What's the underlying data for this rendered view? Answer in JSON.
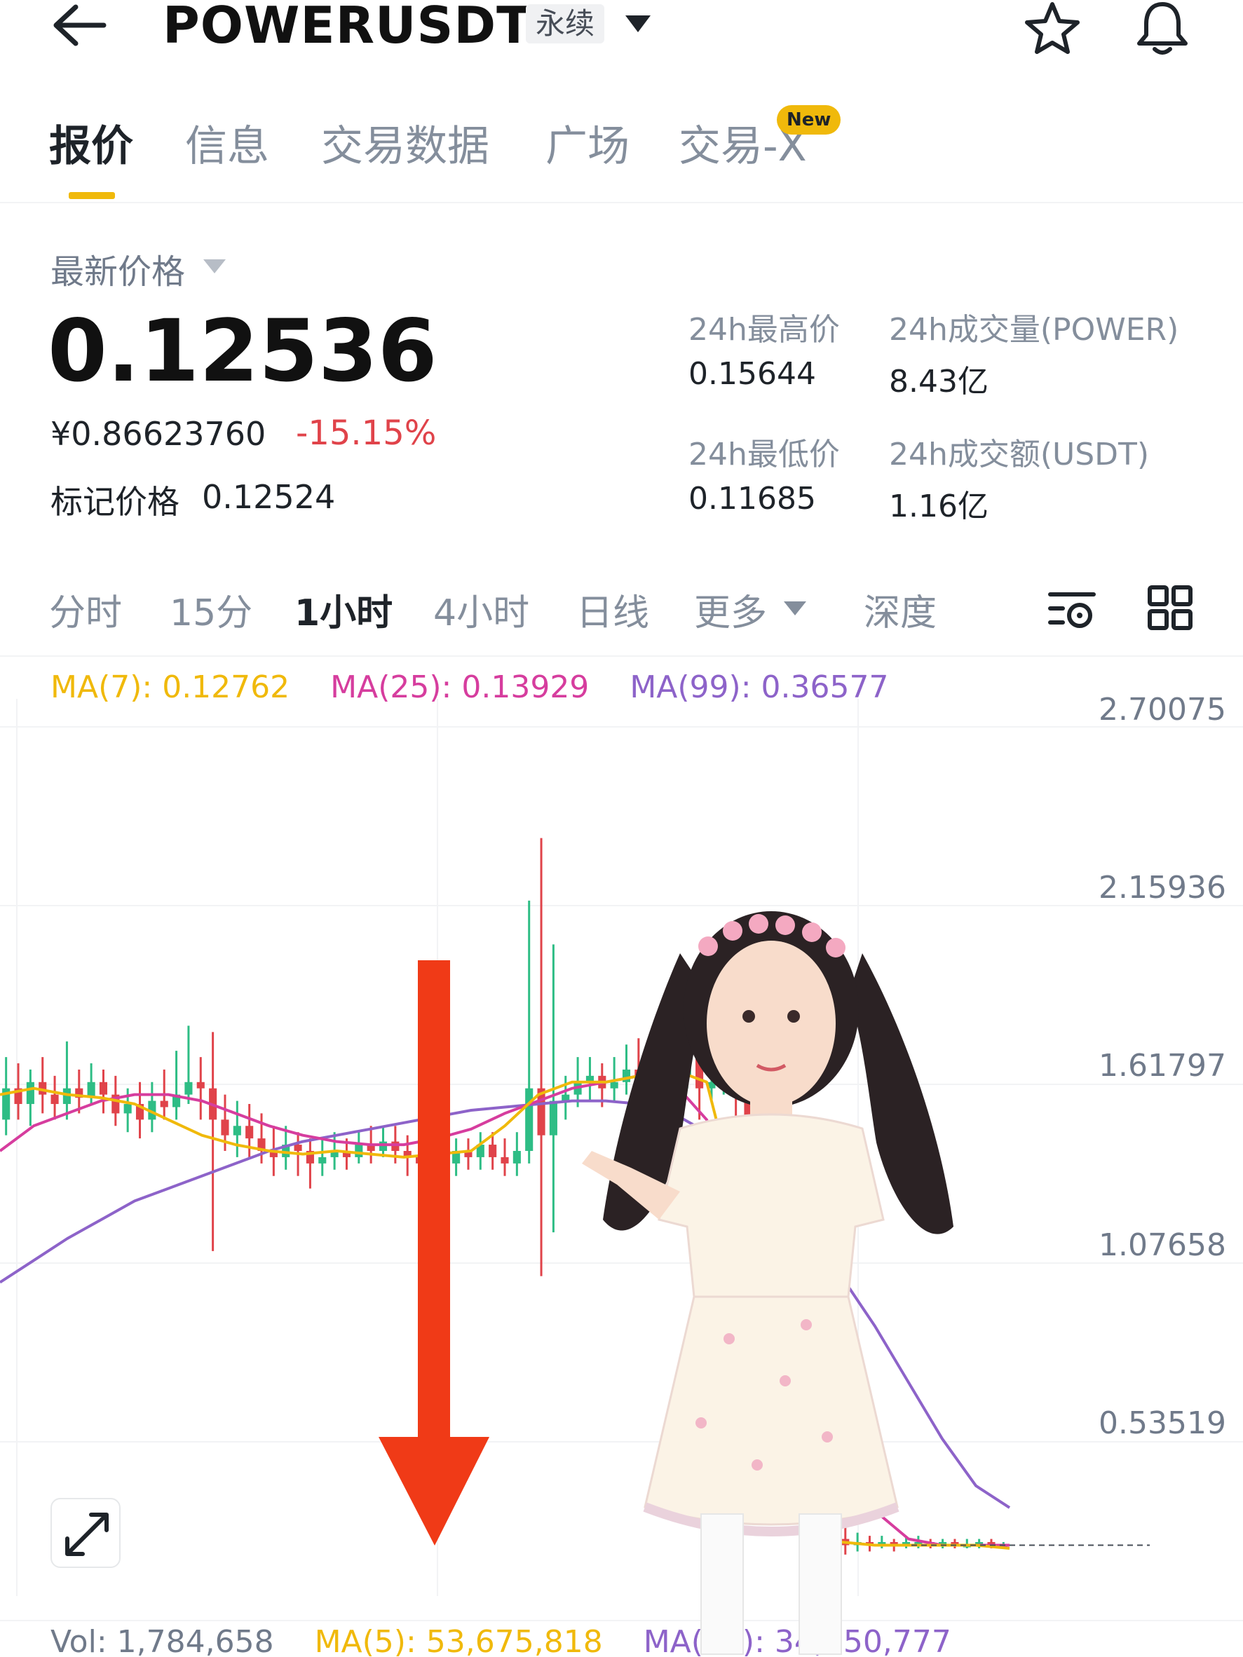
{
  "header": {
    "symbol": "POWERUSDT",
    "contract_type": "永续",
    "icons": [
      "back-arrow-icon",
      "chevron-down-icon",
      "star-icon",
      "bell-icon"
    ]
  },
  "tabs": [
    {
      "label": "报价",
      "active": true
    },
    {
      "label": "信息",
      "active": false
    },
    {
      "label": "交易数据",
      "active": false
    },
    {
      "label": "广场",
      "active": false
    },
    {
      "label": "交易-X",
      "active": false,
      "badge": "New"
    }
  ],
  "price": {
    "latest_label": "最新价格",
    "last": "0.12536",
    "cny": "¥0.86623760",
    "change": "-15.15%",
    "mark_label": "标记价格",
    "mark_value": "0.12524"
  },
  "stats": {
    "high_label": "24h最高价",
    "high_value": "0.15644",
    "vol_base_label": "24h成交量(POWER)",
    "vol_base_value": "8.43亿",
    "low_label": "24h最低价",
    "low_value": "0.11685",
    "vol_quote_label": "24h成交额(USDT)",
    "vol_quote_value": "1.16亿"
  },
  "intervals": [
    {
      "label": "分时",
      "active": false
    },
    {
      "label": "15分",
      "active": false
    },
    {
      "label": "1小时",
      "active": true
    },
    {
      "label": "4小时",
      "active": false
    },
    {
      "label": "日线",
      "active": false
    },
    {
      "label": "更多",
      "active": false
    },
    {
      "label": "深度",
      "active": false
    }
  ],
  "ma": {
    "ma7": "MA(7): 0.12762",
    "ma25": "MA(25): 0.13929",
    "ma99": "MA(99): 0.36577"
  },
  "volume": {
    "vol": "Vol: 1,784,658",
    "ma5": "MA(5): 53,675,818",
    "ma10": "MA(10): 34,650,777"
  },
  "colors": {
    "up": "#2ebd85",
    "down": "#e0434a",
    "ma7": "#f0b90b",
    "ma25": "#d63d9e",
    "ma99": "#8d63c9",
    "accent": "#f0b90b",
    "arrow": "#f03a17"
  },
  "chart_data": {
    "type": "candlestick",
    "ylim": [
      0.0,
      2.8
    ],
    "y_ticks": [
      "2.70075",
      "2.15936",
      "1.61797",
      "1.07658",
      "0.53519"
    ],
    "ma_lines": [
      "MA(7)",
      "MA(25)",
      "MA(99)"
    ],
    "candles": [
      [
        1.5,
        1.6,
        1.7,
        1.45
      ],
      [
        1.6,
        1.55,
        1.68,
        1.5
      ],
      [
        1.55,
        1.62,
        1.66,
        1.48
      ],
      [
        1.62,
        1.58,
        1.7,
        1.52
      ],
      [
        1.58,
        1.55,
        1.64,
        1.5
      ],
      [
        1.55,
        1.6,
        1.75,
        1.5
      ],
      [
        1.6,
        1.57,
        1.66,
        1.52
      ],
      [
        1.57,
        1.62,
        1.68,
        1.55
      ],
      [
        1.62,
        1.58,
        1.66,
        1.52
      ],
      [
        1.58,
        1.52,
        1.64,
        1.48
      ],
      [
        1.52,
        1.55,
        1.6,
        1.46
      ],
      [
        1.55,
        1.5,
        1.62,
        1.44
      ],
      [
        1.5,
        1.56,
        1.62,
        1.46
      ],
      [
        1.56,
        1.54,
        1.66,
        1.5
      ],
      [
        1.54,
        1.58,
        1.72,
        1.5
      ],
      [
        1.58,
        1.62,
        1.8,
        1.55
      ],
      [
        1.62,
        1.6,
        1.7,
        1.5
      ],
      [
        1.6,
        1.5,
        1.78,
        1.08
      ],
      [
        1.5,
        1.45,
        1.58,
        1.4
      ],
      [
        1.45,
        1.48,
        1.56,
        1.38
      ],
      [
        1.48,
        1.44,
        1.55,
        1.38
      ],
      [
        1.44,
        1.4,
        1.52,
        1.36
      ],
      [
        1.4,
        1.38,
        1.48,
        1.32
      ],
      [
        1.38,
        1.42,
        1.48,
        1.34
      ],
      [
        1.42,
        1.4,
        1.46,
        1.32
      ],
      [
        1.4,
        1.36,
        1.44,
        1.28
      ],
      [
        1.36,
        1.38,
        1.44,
        1.32
      ],
      [
        1.38,
        1.4,
        1.46,
        1.34
      ],
      [
        1.4,
        1.38,
        1.44,
        1.34
      ],
      [
        1.38,
        1.42,
        1.46,
        1.36
      ],
      [
        1.42,
        1.4,
        1.48,
        1.36
      ],
      [
        1.4,
        1.43,
        1.48,
        1.38
      ],
      [
        1.43,
        1.4,
        1.48,
        1.36
      ],
      [
        1.4,
        1.38,
        1.45,
        1.32
      ],
      [
        1.38,
        1.36,
        1.43,
        1.3
      ],
      [
        1.36,
        1.38,
        1.42,
        1.32
      ],
      [
        1.38,
        1.36,
        1.42,
        1.3
      ],
      [
        1.36,
        1.4,
        1.44,
        1.32
      ],
      [
        1.4,
        1.38,
        1.44,
        1.34
      ],
      [
        1.38,
        1.42,
        1.46,
        1.34
      ],
      [
        1.42,
        1.38,
        1.46,
        1.34
      ],
      [
        1.38,
        1.36,
        1.44,
        1.32
      ],
      [
        1.36,
        1.4,
        1.46,
        1.32
      ],
      [
        1.4,
        1.6,
        2.2,
        1.36
      ],
      [
        1.6,
        1.45,
        2.4,
        1.0
      ],
      [
        1.45,
        1.56,
        2.06,
        1.14
      ],
      [
        1.56,
        1.58,
        1.64,
        1.5
      ],
      [
        1.58,
        1.62,
        1.7,
        1.54
      ],
      [
        1.62,
        1.64,
        1.7,
        1.56
      ],
      [
        1.64,
        1.6,
        1.68,
        1.54
      ],
      [
        1.6,
        1.62,
        1.7,
        1.56
      ],
      [
        1.62,
        1.66,
        1.74,
        1.58
      ],
      [
        1.66,
        1.6,
        1.76,
        1.56
      ],
      [
        1.6,
        1.62,
        1.7,
        1.56
      ],
      [
        1.62,
        1.58,
        1.68,
        1.52
      ],
      [
        1.58,
        1.64,
        1.76,
        1.52
      ],
      [
        1.64,
        1.7,
        1.76,
        1.6
      ],
      [
        1.7,
        1.6,
        1.78,
        1.5
      ],
      [
        1.6,
        1.62,
        1.72,
        1.56
      ],
      [
        1.62,
        1.66,
        1.7,
        1.58
      ],
      [
        1.66,
        1.58,
        1.68,
        1.2
      ],
      [
        1.58,
        1.4,
        1.6,
        1.3
      ],
      [
        1.4,
        1.1,
        1.42,
        0.9
      ],
      [
        1.1,
        0.6,
        1.12,
        0.5
      ],
      [
        0.6,
        0.48,
        0.66,
        0.4
      ],
      [
        0.48,
        0.4,
        0.54,
        0.32
      ],
      [
        0.4,
        0.3,
        0.44,
        0.22
      ],
      [
        0.3,
        0.2,
        0.34,
        0.16
      ],
      [
        0.2,
        0.16,
        0.24,
        0.12
      ],
      [
        0.16,
        0.14,
        0.2,
        0.11
      ],
      [
        0.14,
        0.15,
        0.18,
        0.12
      ],
      [
        0.15,
        0.14,
        0.17,
        0.12
      ],
      [
        0.14,
        0.15,
        0.17,
        0.13
      ],
      [
        0.15,
        0.14,
        0.16,
        0.12
      ],
      [
        0.14,
        0.15,
        0.17,
        0.13
      ],
      [
        0.15,
        0.15,
        0.17,
        0.13
      ],
      [
        0.15,
        0.14,
        0.16,
        0.13
      ],
      [
        0.14,
        0.15,
        0.16,
        0.13
      ],
      [
        0.15,
        0.14,
        0.16,
        0.13
      ],
      [
        0.14,
        0.14,
        0.16,
        0.13
      ],
      [
        0.14,
        0.15,
        0.16,
        0.13
      ],
      [
        0.15,
        0.14,
        0.16,
        0.13
      ],
      [
        0.14,
        0.14,
        0.15,
        0.13
      ]
    ],
    "ma7": [
      1.58,
      1.6,
      1.58,
      1.57,
      1.55,
      1.5,
      1.45,
      1.42,
      1.4,
      1.39,
      1.4,
      1.39,
      1.38,
      1.39,
      1.4,
      1.48,
      1.58,
      1.62,
      1.62,
      1.64,
      1.66,
      1.62,
      1.2,
      0.55,
      0.25,
      0.15,
      0.14,
      0.14,
      0.14,
      0.14,
      0.13
    ],
    "ma25": [
      1.4,
      1.48,
      1.52,
      1.56,
      1.58,
      1.58,
      1.56,
      1.52,
      1.48,
      1.45,
      1.43,
      1.42,
      1.42,
      1.44,
      1.47,
      1.52,
      1.56,
      1.6,
      1.62,
      1.64,
      1.62,
      1.5,
      1.25,
      0.95,
      0.7,
      0.45,
      0.25,
      0.16,
      0.14,
      0.14,
      0.14
    ],
    "ma99": [
      0.98,
      1.05,
      1.12,
      1.18,
      1.24,
      1.28,
      1.32,
      1.36,
      1.4,
      1.43,
      1.45,
      1.47,
      1.49,
      1.51,
      1.53,
      1.54,
      1.55,
      1.56,
      1.56,
      1.55,
      1.52,
      1.46,
      1.38,
      1.28,
      1.15,
      1.0,
      0.84,
      0.66,
      0.48,
      0.33,
      0.26
    ]
  }
}
